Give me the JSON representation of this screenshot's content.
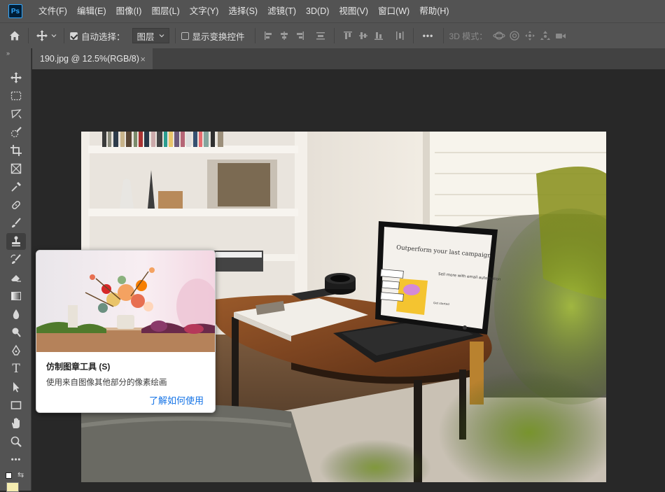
{
  "app": {
    "logo_text": "Ps"
  },
  "menu": [
    "文件(F)",
    "编辑(E)",
    "图像(I)",
    "图层(L)",
    "文字(Y)",
    "选择(S)",
    "滤镜(T)",
    "3D(D)",
    "视图(V)",
    "窗口(W)",
    "帮助(H)"
  ],
  "options": {
    "auto_select_label": "自动选择：",
    "auto_select_checked": true,
    "layer_select_value": "图层",
    "show_transform_label": "显示变换控件",
    "show_transform_checked": false,
    "more_label": "•••",
    "mode_3d_label": "3D 模式："
  },
  "document_tab": {
    "title": "190.jpg @ 12.5%(RGB/8)",
    "close": "×"
  },
  "toolbar": {
    "tools": [
      "move-tool",
      "marquee-tool",
      "lasso-tool",
      "quick-select-tool",
      "crop-tool",
      "frame-tool",
      "eyedropper-tool",
      "healing-tool",
      "brush-tool",
      "clone-stamp-tool",
      "history-brush-tool",
      "eraser-tool",
      "gradient-tool",
      "blur-tool",
      "dodge-tool",
      "pen-tool",
      "type-tool",
      "path-select-tool",
      "rectangle-tool",
      "hand-tool",
      "zoom-tool",
      "more-tools"
    ],
    "active_tool": "clone-stamp-tool",
    "type_tool_glyph": "T",
    "more_glyph": "•••",
    "foreground_color": "#ffffff",
    "background_color": "#f4ecb0"
  },
  "tooltip": {
    "title": "仿制图章工具 (S)",
    "description": "使用来自图像其他部分的像素绘画",
    "link": "了解如何使用"
  },
  "laptop_screen": {
    "heading": "Outperform your last campaign",
    "side_text": "Sell more with email automation",
    "button": "Get started"
  },
  "colors": {
    "accent": "#31a8ff",
    "link": "#1473e6",
    "panel": "#535353",
    "canvas_bg": "#282828"
  }
}
